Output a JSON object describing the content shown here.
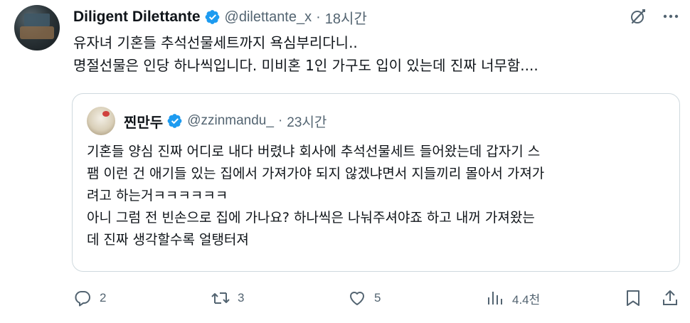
{
  "author": {
    "display_name": "Diligent Dilettante",
    "handle": "@dilettante_x",
    "separator": "·",
    "time": "18시간"
  },
  "top_icons": [
    "grok-icon",
    "more-icon"
  ],
  "tweet": {
    "lines": [
      "유자녀 기혼들 추석선물세트까지 욕심부리다니..",
      "명절선물은 인당 하나씩입니다. 미비혼 1인 가구도 입이 있는데 진짜 너무함...."
    ]
  },
  "quoted": {
    "display_name": "찐만두",
    "handle": "@zzinmandu_",
    "separator": "·",
    "time": "23시간",
    "lines": [
      "기혼들 양심 진짜 어디로 내다 버렸냐 회사에 추석선물세트 들어왔는데 갑자기 스",
      "팸 이런 건 애기들 있는 집에서 가져가야 되지 않겠냐면서 지들끼리 몰아서 가져가",
      "려고 하는거ㅋㅋㅋㅋㅋㅋ",
      "아니 그럼 전 빈손으로 집에 가나요? 하나씩은 나눠주셔야죠 하고 내꺼 가져왔는",
      "데 진짜 생각할수록 얼탱터져"
    ]
  },
  "actions": {
    "replies": "2",
    "reposts": "3",
    "likes": "5",
    "views": "4.4천"
  },
  "colors": {
    "text": "#0f1419",
    "secondary": "#536471",
    "verified": "#1d9bf0",
    "border": "#cfd9de"
  }
}
